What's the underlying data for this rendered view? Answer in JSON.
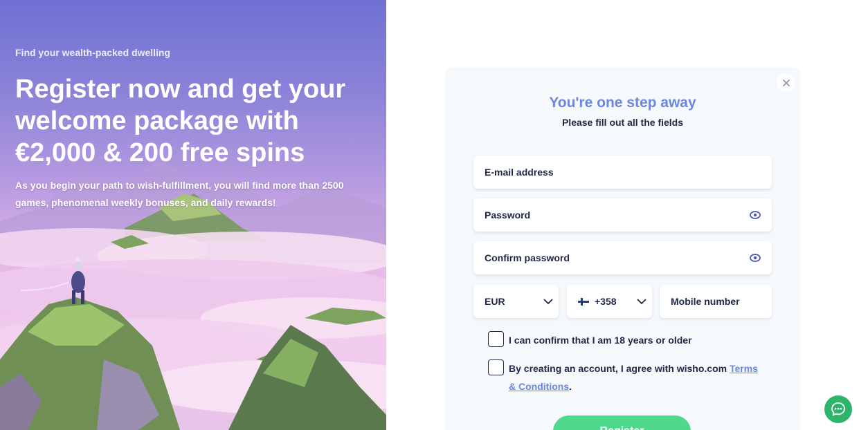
{
  "hero": {
    "eyebrow": "Find your wealth-packed dwelling",
    "headline": "Register now and get your welcome package with €2,000 & 200 free spins",
    "sub": "As you begin your path to wish-fulfillment, you will find more than 2500 games, phenomenal weekly bonuses, and daily rewards!"
  },
  "form": {
    "title": "You're one step away",
    "subtitle": "Please fill out all the fields",
    "email_placeholder": "E-mail address",
    "password_placeholder": "Password",
    "confirm_placeholder": "Confirm password",
    "currency_value": "EUR",
    "phone_code_value": "+358",
    "mobile_placeholder": "Mobile number",
    "age_confirm_label": "I can confirm that I am 18 years or older",
    "terms_prefix": "By creating an account, I agree with wisho.com ",
    "terms_link": "Terms & Conditions",
    "terms_suffix": ".",
    "register_label": "Register"
  },
  "icons": {
    "close": "close-icon",
    "eye": "eye-icon",
    "chevron": "chevron-down-icon",
    "flag": "finland-flag-icon",
    "chat": "chat-bubble-icon"
  },
  "colors": {
    "accent_blue": "#6b86e0",
    "text_dark": "#1f2747",
    "register_green": "#4fd98c",
    "chat_green": "#2db56c",
    "card_bg": "#f6f9fc"
  }
}
